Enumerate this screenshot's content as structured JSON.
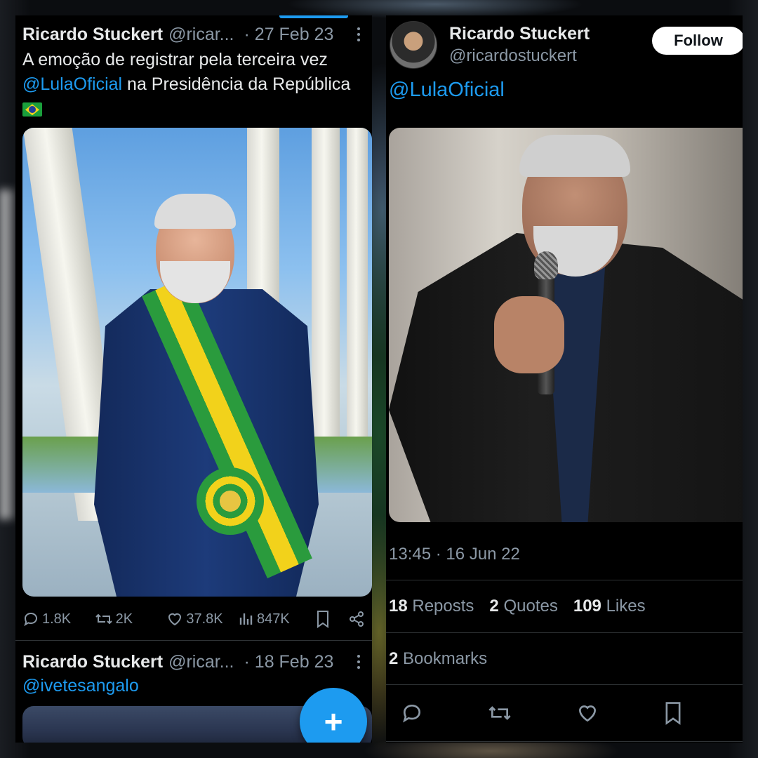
{
  "left_post": {
    "author_name": "Ricardo Stuckert",
    "author_handle": "@ricar...",
    "date": "· 27 Feb 23",
    "text_part1": "A emoção de registrar pela terceira vez",
    "mention": "@LulaOficial",
    "text_part2": " na Presidência da República",
    "flag_icon": "brazil-flag-icon",
    "stats": {
      "replies": "1.8K",
      "reposts": "2K",
      "likes": "37.8K",
      "views": "847K"
    }
  },
  "left_post_2": {
    "author_name": "Ricardo Stuckert",
    "author_handle": "@ricar...",
    "date": "· 18 Feb 23",
    "mention": "@ivetesangalo"
  },
  "fab": {
    "icon": "compose-plus-icon",
    "label": "+"
  },
  "right_post": {
    "author_name": "Ricardo Stuckert",
    "author_handle": "@ricardostuckert",
    "follow_label": "Follow",
    "mention": "@LulaOficial",
    "timestamp": "13:45 · 16 Jun 22",
    "reposts_count": "18",
    "reposts_label": "Reposts",
    "quotes_count": "2",
    "quotes_label": "Quotes",
    "likes_count": "109",
    "likes_label": "Likes",
    "bookmarks_count": "2",
    "bookmarks_label": "Bookmarks"
  },
  "colors": {
    "accent": "#1d9bf0",
    "background": "#000000",
    "secondary_text": "#8b98a5",
    "primary_text": "#e7e9ea"
  }
}
